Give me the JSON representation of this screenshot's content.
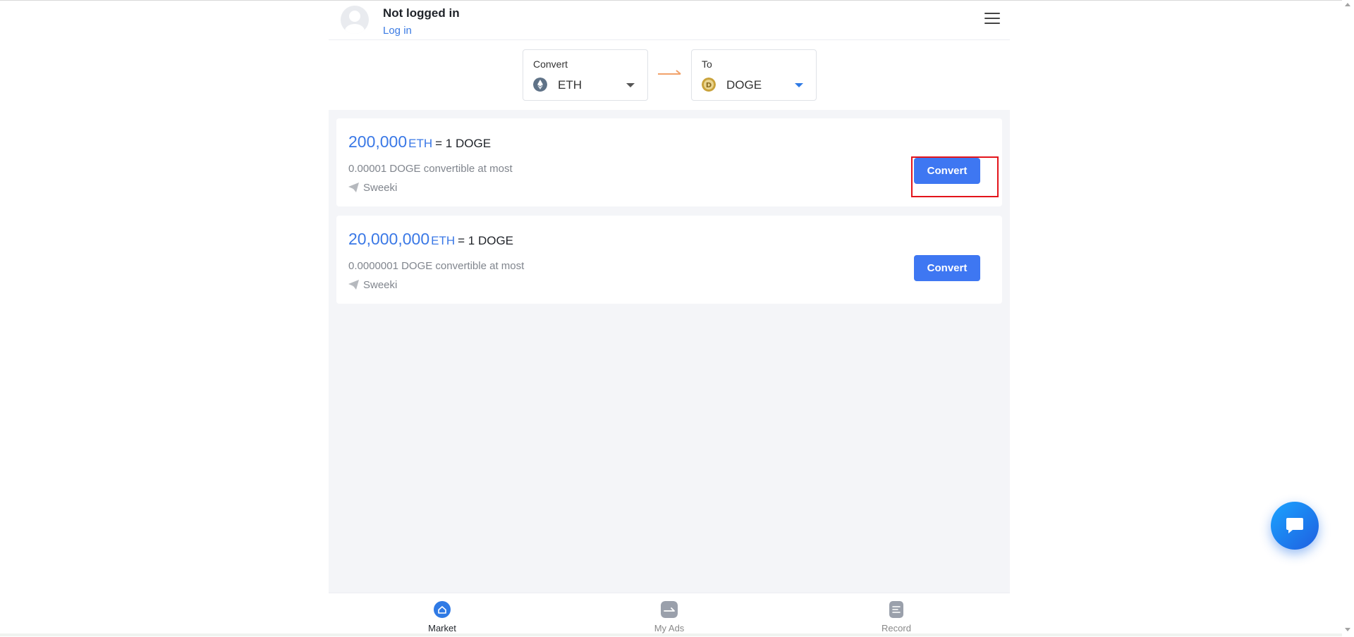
{
  "header": {
    "user_status": "Not logged in",
    "login_label": "Log in"
  },
  "selector": {
    "from_label": "Convert",
    "from_coin": "ETH",
    "to_label": "To",
    "to_coin": "DOGE"
  },
  "offers": [
    {
      "amount": "200,000",
      "unit": "ETH",
      "equals": "= 1 DOGE",
      "limit": "0.00001 DOGE convertible at most",
      "merchant": "Sweeki",
      "button_label": "Convert"
    },
    {
      "amount": "20,000,000",
      "unit": "ETH",
      "equals": "= 1 DOGE",
      "limit": "0.0000001 DOGE convertible at most",
      "merchant": "Sweeki",
      "button_label": "Convert"
    }
  ],
  "nav": {
    "market": "Market",
    "my_ads": "My Ads",
    "record": "Record"
  },
  "colors": {
    "accent": "#3e77f2",
    "link": "#3b7be3",
    "highlight": "#e3141b",
    "background": "#f4f5f8"
  },
  "icons": [
    "menu-icon",
    "eth-icon",
    "doge-icon",
    "arrow-right-icon",
    "send-icon",
    "home-icon",
    "ads-icon",
    "record-icon",
    "chat-icon"
  ]
}
